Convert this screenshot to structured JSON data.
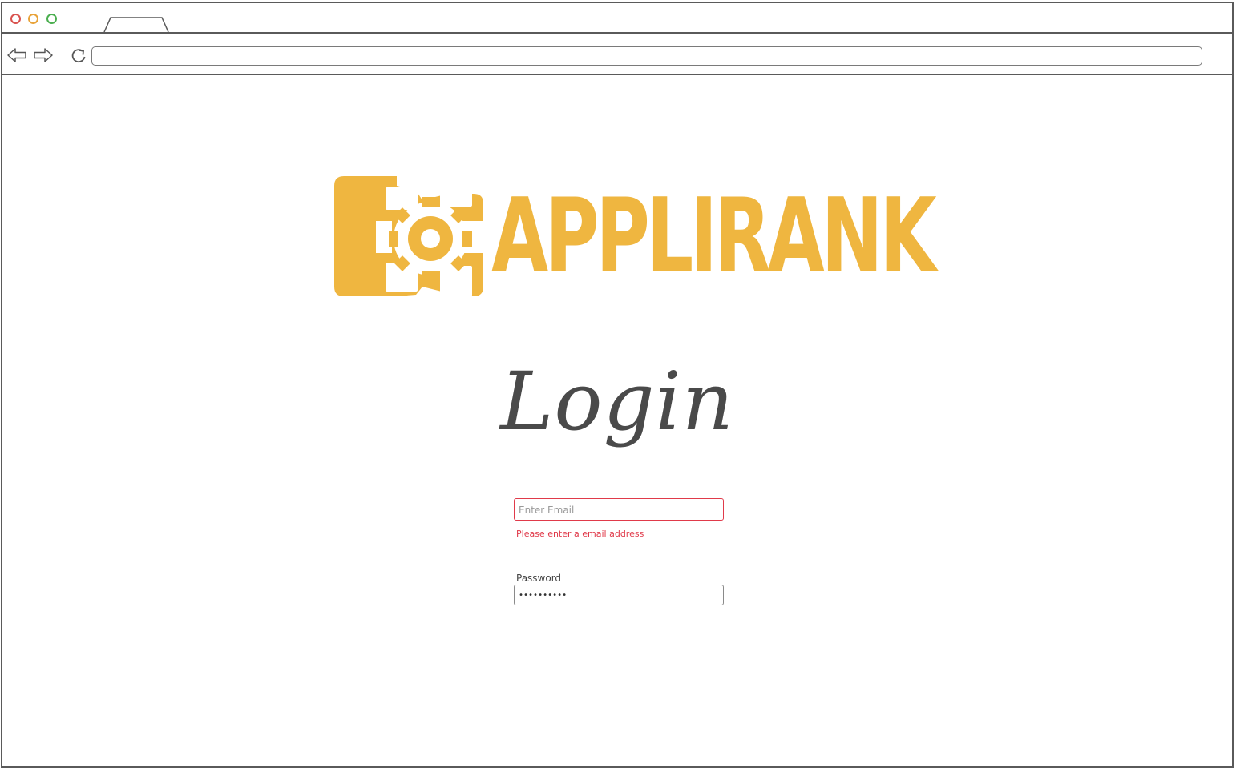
{
  "colors": {
    "brand": "#efb640",
    "error": "#e03a4a",
    "dot_red": "#d9534f",
    "dot_yellow": "#e8a33a",
    "dot_green": "#4caf50"
  },
  "browser": {
    "icons": {
      "back": "back-arrow-icon",
      "forward": "forward-arrow-icon",
      "reload": "reload-icon"
    },
    "address_value": ""
  },
  "logo": {
    "text": "APPLIRANK",
    "icon": "gear-icon"
  },
  "page": {
    "title": "Login"
  },
  "form": {
    "email": {
      "placeholder": "Enter Email",
      "value": "",
      "error": "Please enter a email address"
    },
    "password": {
      "label": "Password",
      "value": "••••••••••"
    }
  }
}
